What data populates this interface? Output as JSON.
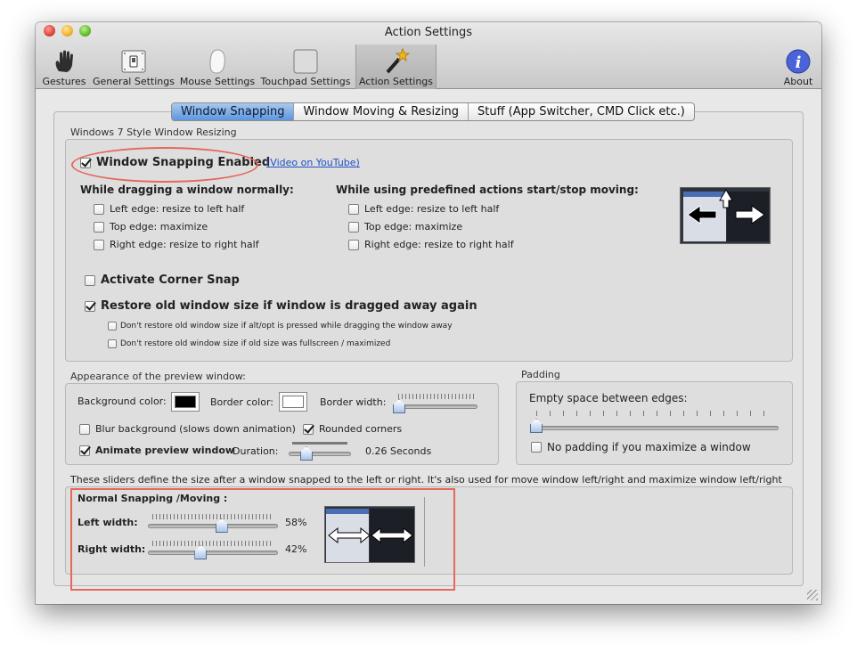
{
  "window": {
    "title": "Action Settings"
  },
  "toolbar": {
    "items": [
      {
        "label": "Gestures",
        "icon": "hand-icon"
      },
      {
        "label": "General Settings",
        "icon": "switch-icon"
      },
      {
        "label": "Mouse Settings",
        "icon": "mouse-icon"
      },
      {
        "label": "Touchpad Settings",
        "icon": "touchpad-icon"
      },
      {
        "label": "Action Settings",
        "icon": "magic-wand-icon",
        "selected": true
      },
      {
        "label": "About",
        "icon": "info-icon"
      }
    ]
  },
  "tabs": [
    {
      "label": "Window Snapping",
      "active": true
    },
    {
      "label": "Window Moving & Resizing"
    },
    {
      "label": "Stuff (App Switcher, CMD Click etc.)"
    }
  ],
  "section1": {
    "label": "Windows 7 Style Window Resizing",
    "snapping_enabled": {
      "label": "Window Snapping Enabled",
      "checked": true
    },
    "youtube_link": "(Video on YouTube)",
    "normal": {
      "heading": "While dragging a window normally:",
      "options": [
        {
          "label": "Left edge: resize to left half",
          "checked": false
        },
        {
          "label": "Top edge: maximize",
          "checked": false
        },
        {
          "label": "Right edge: resize to right half",
          "checked": false
        }
      ]
    },
    "predefined": {
      "heading": "While using predefined actions start/stop moving:",
      "options": [
        {
          "label": "Left edge: resize to left half",
          "checked": false
        },
        {
          "label": "Top edge: maximize",
          "checked": false
        },
        {
          "label": "Right edge: resize to right half",
          "checked": false
        }
      ]
    },
    "corner_snap": {
      "label": "Activate Corner Snap",
      "checked": false
    },
    "restore": {
      "label": "Restore old window size if window is dragged away again",
      "checked": true
    },
    "restore_sub": [
      {
        "label": "Don't restore old window size if alt/opt is pressed while dragging the window away",
        "checked": false
      },
      {
        "label": "Don't restore old window size if old size was fullscreen / maximized",
        "checked": false
      }
    ]
  },
  "appearance": {
    "label": "Appearance of the preview window:",
    "background_color_label": "Background color:",
    "background_color": "#000000",
    "border_color_label": "Border color:",
    "border_color": "#ffffff",
    "border_width_label": "Border width:",
    "border_width_value": 0,
    "blur": {
      "label": "Blur background (slows down animation)",
      "checked": false
    },
    "rounded": {
      "label": "Rounded corners",
      "checked": true
    },
    "animate": {
      "label": "Animate preview window",
      "checked": true
    },
    "duration_label": "Duration:",
    "duration_value": "0.26 Seconds"
  },
  "padding": {
    "label": "Padding",
    "empty_space_label": "Empty space between edges:",
    "empty_space_value": 0,
    "no_padding": {
      "label": "No padding if you maximize a window",
      "checked": false
    }
  },
  "sizes": {
    "description": "These sliders define the size after a window snapped to the left or right. It's also used for move window left/right and maximize window left/right",
    "heading": "Normal Snapping /Moving :",
    "left_label": "Left width:",
    "left_value": "58%",
    "left_fraction": 0.58,
    "right_label": "Right width:",
    "right_value": "42%",
    "right_fraction": 0.42
  },
  "colors": {
    "accent": "#5d96de",
    "annotation": "#e5685b"
  }
}
